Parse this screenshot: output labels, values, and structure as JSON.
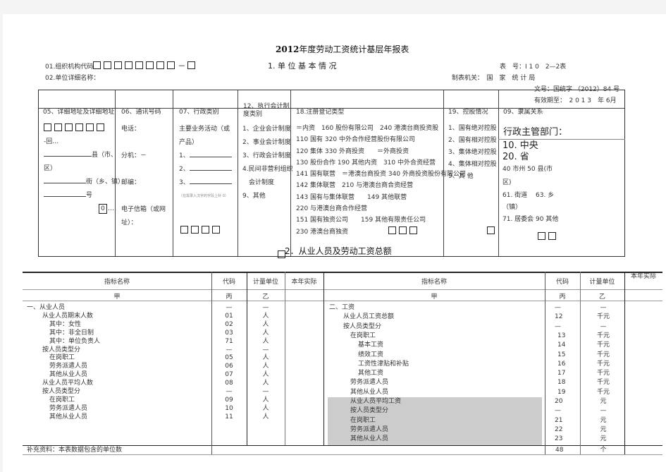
{
  "title": {
    "year": "2012",
    "rest": "年度劳动工资统计基层年报表"
  },
  "header_left": {
    "org_code_label": "01.组织机构代码",
    "org_code_boxes": 8,
    "org_code_sep": "－",
    "unit_name_label": "02.单位详细名称："
  },
  "section1_title": "1. 单 位 基 本 情 况",
  "header_right": {
    "form_no": "表　号：I 1 0　2—2表",
    "issuer": "制表机关：　国　家　统 计 局",
    "doc_no": "文号：国统字 （2012）84 号",
    "valid_until": "有效期至：　2 0 1 3　年 6月"
  },
  "section1": {
    "col05": {
      "header": "05、详细地址及详细地址",
      "code_suffix": "-回…",
      "county": "县（市、",
      "district": "区）",
      "street": "街（乡、镇）",
      "number": "号",
      "zero_box": "0",
      "ellipsis": "…"
    },
    "col06": {
      "header": "06、通讯号码",
      "phone": "电话：",
      "ext": "分机：－",
      "postcode": "邮编：",
      "email": "电子信箱（或网址）："
    },
    "col07": {
      "header": "07、行政类别",
      "main_business": "主要业务活动（或产品）",
      "item1": "1、",
      "item2": "2、",
      "item3": "3、",
      "note": "（在需录入汉字的字段上补 0）"
    },
    "col12": {
      "header": "12、执行会计制度类别",
      "options": [
        "1、企业会计制度",
        "2、事业会计制度",
        "3、行政会计制度",
        "4.民间非营利组织",
        "　会计制度",
        "9、其他"
      ]
    },
    "col18": {
      "header": "18.注册登记类型",
      "lines": [
        "＝内资　160 股份有限公司　240 港澳台商投资股",
        "110 国有 320 中外合作经营股份有限公司",
        "120 集体 330 外商投资　　＝外商投资",
        "130 股份合作 190 其他内资　310 中外合资经营",
        "141 国有联营　＝港澳台商投资 340 外商投资股份有限公司",
        "142 集体联营　210 与港澳台商合资经营",
        "143 国有与集体联营　　149 其他联营",
        "220 与港澳台商合作经营",
        "151 国有独资公司　　159 其他有限责任公司",
        "230 港澳台商独资"
      ]
    },
    "col19": {
      "header": "19、控股情况",
      "options": [
        "1、国有绝对控股",
        "2、国有相对控股",
        "3、集体绝对控股",
        "4、集体相对控股",
        "9、其 他"
      ]
    },
    "col09": {
      "header": "09、隶属关系",
      "admin_label": "行政主管部门：",
      "central_province": "10. 中央　 20. 省",
      "city_county": "40 市州 50 县(市区)",
      "street_town": "61. 街道　 63. 乡（镇）",
      "committee_other": "71. 居委会 90 其他"
    }
  },
  "section2": {
    "title": "2．从业人员及劳动工资总额",
    "headers": {
      "indicator": "指标名称",
      "code": "代码",
      "unit": "计量单位",
      "actual": "本年实际"
    },
    "subheaders": {
      "indicator": "甲",
      "code": "丙",
      "unit": "乙"
    },
    "left_rows": [
      {
        "name": "一、从业人员",
        "indent": 0,
        "code": "—",
        "unit": "—"
      },
      {
        "name": "从业人员期末人数",
        "indent": 1,
        "code": "01",
        "unit": "人"
      },
      {
        "name": "其中：女性",
        "indent": 2,
        "code": "02",
        "unit": "人"
      },
      {
        "name": "其中：非全日制",
        "indent": 2,
        "code": "03",
        "unit": "人"
      },
      {
        "name": "其中：单位负责人",
        "indent": 2,
        "code": "71",
        "unit": "人"
      },
      {
        "name": "按人员类型分",
        "indent": 1,
        "code": "—",
        "unit": "—"
      },
      {
        "name": "在岗职工",
        "indent": 2,
        "code": "05",
        "unit": "人"
      },
      {
        "name": "劳务派遣人员",
        "indent": 2,
        "code": "06",
        "unit": "人"
      },
      {
        "name": "其他从业人员",
        "indent": 2,
        "code": "07",
        "unit": "人"
      },
      {
        "name": "从业人员平均人数",
        "indent": 1,
        "code": "08",
        "unit": "人"
      },
      {
        "name": "按人员类型分",
        "indent": 1,
        "code": "—",
        "unit": "—"
      },
      {
        "name": "在岗职工",
        "indent": 2,
        "code": "09",
        "unit": "人"
      },
      {
        "name": "劳务派遣人员",
        "indent": 2,
        "code": "10",
        "unit": "人"
      },
      {
        "name": "其他从业人员",
        "indent": 2,
        "code": "11",
        "unit": "人"
      }
    ],
    "right_rows": [
      {
        "name": "二、工资",
        "indent": 0,
        "code": "—",
        "unit": "—",
        "shaded": false
      },
      {
        "name": "从业人员工资总额",
        "indent": 1,
        "code": "12",
        "unit": "千元",
        "shaded": false
      },
      {
        "name": "按人员类型分",
        "indent": 1,
        "code": "—",
        "unit": "—",
        "shaded": false
      },
      {
        "name": "在岗职工",
        "indent": 2,
        "code": "13",
        "unit": "千元",
        "shaded": false
      },
      {
        "name": "基本工资",
        "indent": 3,
        "code": "14",
        "unit": "千元",
        "shaded": false
      },
      {
        "name": "绩效工资",
        "indent": 3,
        "code": "15",
        "unit": "千元",
        "shaded": false
      },
      {
        "name": "工资性津贴和补贴",
        "indent": 3,
        "code": "16",
        "unit": "千元",
        "shaded": false
      },
      {
        "name": "其他工资",
        "indent": 3,
        "code": "17",
        "unit": "千元",
        "shaded": false
      },
      {
        "name": "劳务派遣人员",
        "indent": 2,
        "code": "18",
        "unit": "千元",
        "shaded": false
      },
      {
        "name": "其他从业人员",
        "indent": 2,
        "code": "19",
        "unit": "千元",
        "shaded": false
      },
      {
        "name": "从业人员平均工资",
        "indent": 2,
        "code": "20",
        "unit": "元",
        "shaded": true
      },
      {
        "name": "按人员类型分",
        "indent": 2,
        "code": "—",
        "unit": "—",
        "shaded": true
      },
      {
        "name": "在岗职工",
        "indent": 2,
        "code": "21",
        "unit": "元",
        "shaded": true
      },
      {
        "name": "劳务派遣人员",
        "indent": 2,
        "code": "22",
        "unit": "元",
        "shaded": true
      },
      {
        "name": "其他从业人员",
        "indent": 2,
        "code": "23",
        "unit": "元",
        "shaded": true
      }
    ],
    "supplement": {
      "label": "补充资料：本表数据包含的单位数",
      "code": "48",
      "unit": "个"
    }
  }
}
